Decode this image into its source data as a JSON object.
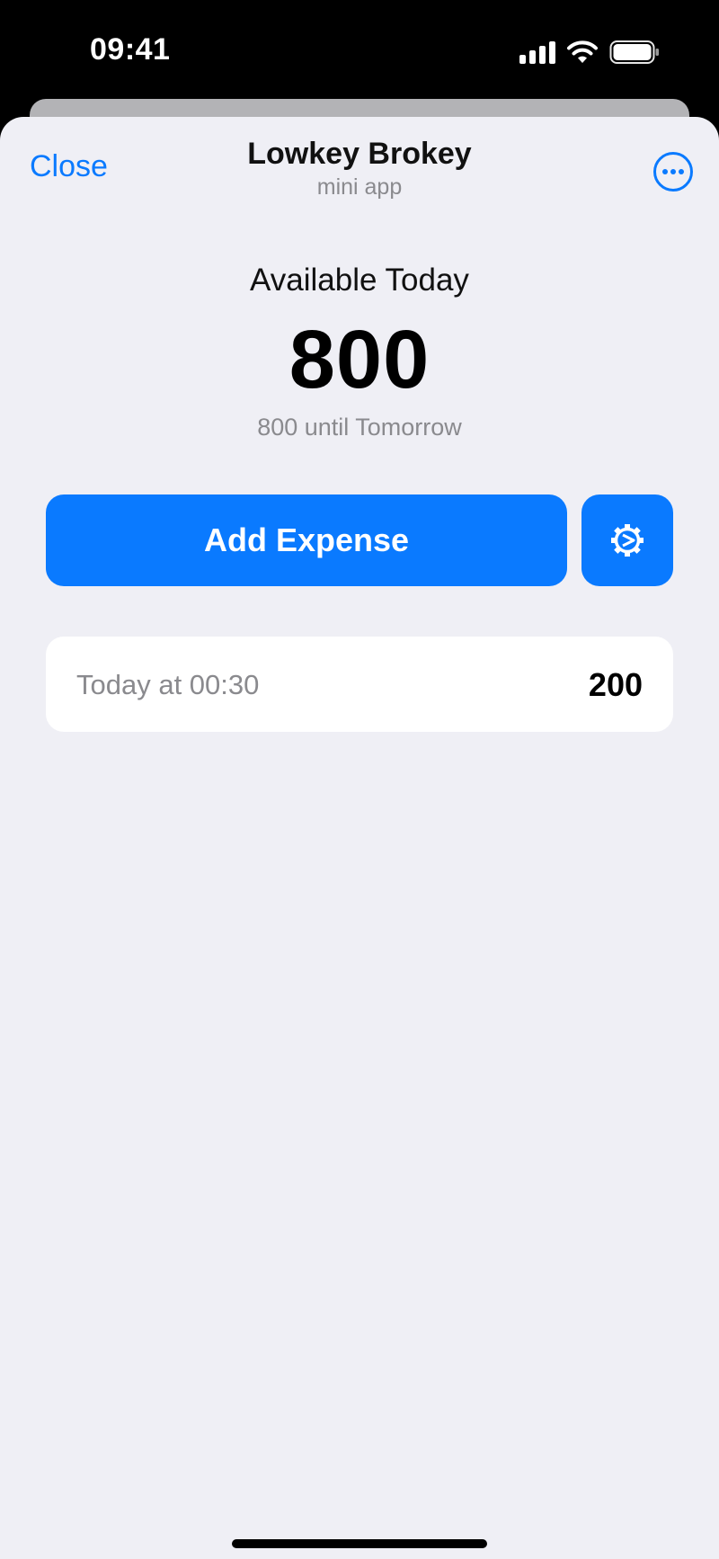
{
  "status_bar": {
    "time": "09:41",
    "icons": [
      "cellular-signal-icon",
      "wifi-icon",
      "battery-icon"
    ]
  },
  "header": {
    "close_label": "Close",
    "title": "Lowkey Brokey",
    "subtitle": "mini app",
    "more_icon": "ellipsis-circle-icon"
  },
  "summary": {
    "label": "Available Today",
    "amount": "800",
    "note": "800 until Tomorrow"
  },
  "actions": {
    "add_expense_label": "Add Expense",
    "settings_icon": "gear-icon"
  },
  "expenses": [
    {
      "date": "Today at 00:30",
      "amount": "200"
    }
  ],
  "colors": {
    "accent": "#0a7aff",
    "background": "#efeff5",
    "card": "#ffffff",
    "secondary_text": "#8a8a8e"
  }
}
